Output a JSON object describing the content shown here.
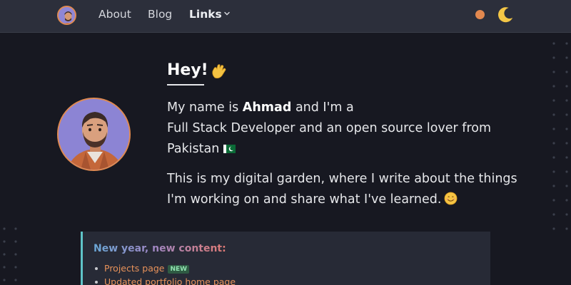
{
  "nav": {
    "about": "About",
    "blog": "Blog",
    "links": "Links",
    "avatar_icon": "avatar-icon",
    "theme_icon": "moon-icon",
    "accent": "#e2884f"
  },
  "hero": {
    "greeting": "Hey!",
    "intro_prefix": "My name is",
    "name": "Ahmad",
    "intro_suffix": "and I'm a",
    "role_line": "Full Stack Developer and an open source lover from",
    "country": "Pakistan",
    "garden_text": "This is my digital garden, where I write about the things I'm working on and share what I've learned."
  },
  "callout": {
    "title": "New year, new content:",
    "items": [
      {
        "label": "Projects page",
        "badge": "NEW"
      },
      {
        "label": "Updated portfolio home page"
      }
    ],
    "border_color": "#5fc3c8"
  }
}
